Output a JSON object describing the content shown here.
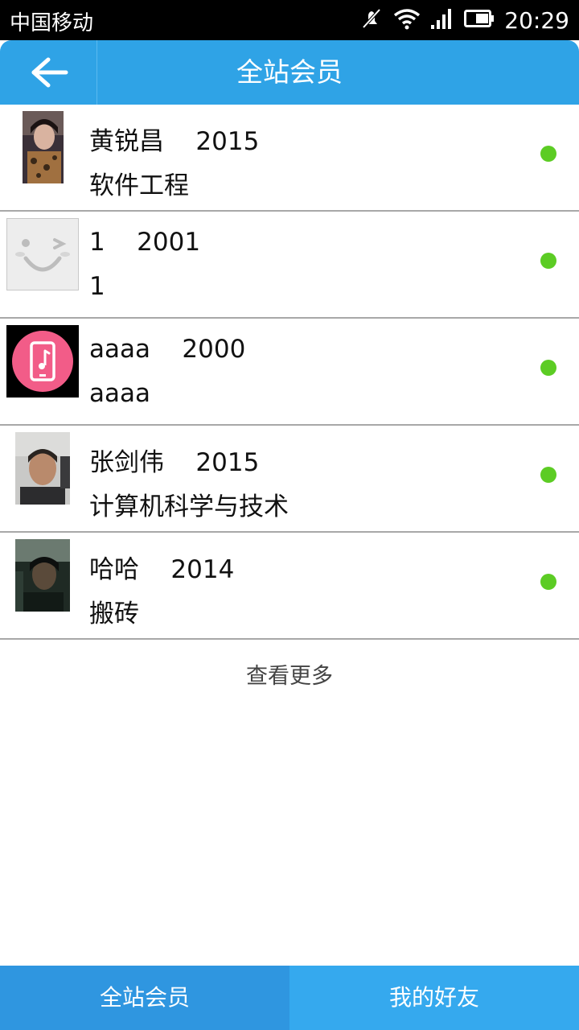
{
  "status_bar": {
    "carrier": "中国移动",
    "time": "20:29",
    "icons": [
      "mute-icon",
      "wifi-icon",
      "signal-icon",
      "battery-icon"
    ]
  },
  "header": {
    "title": "全站会员",
    "back_icon": "arrow-left-icon"
  },
  "members": [
    {
      "name": "黄锐昌",
      "year": "2015",
      "major": "软件工程",
      "online": true,
      "avatar": "photo"
    },
    {
      "name": "1",
      "year": "2001",
      "major": "1",
      "online": true,
      "avatar": "smiley-face"
    },
    {
      "name": "aaaa",
      "year": "2000",
      "major": "aaaa",
      "online": true,
      "avatar": "music-phone"
    },
    {
      "name": "张剑伟",
      "year": "2015",
      "major": "计算机科学与技术",
      "online": true,
      "avatar": "photo"
    },
    {
      "name": "哈哈",
      "year": "2014",
      "major": "搬砖",
      "online": true,
      "avatar": "photo"
    }
  ],
  "load_more": "查看更多",
  "tabs": [
    {
      "label": "全站会员",
      "active": true
    },
    {
      "label": "我的好友",
      "active": false
    }
  ],
  "colors": {
    "header_bg": "#2fa3e6",
    "online_dot": "#5ccc24",
    "tab_active": "#2f96e0",
    "tab_inactive": "#35a9ee"
  }
}
